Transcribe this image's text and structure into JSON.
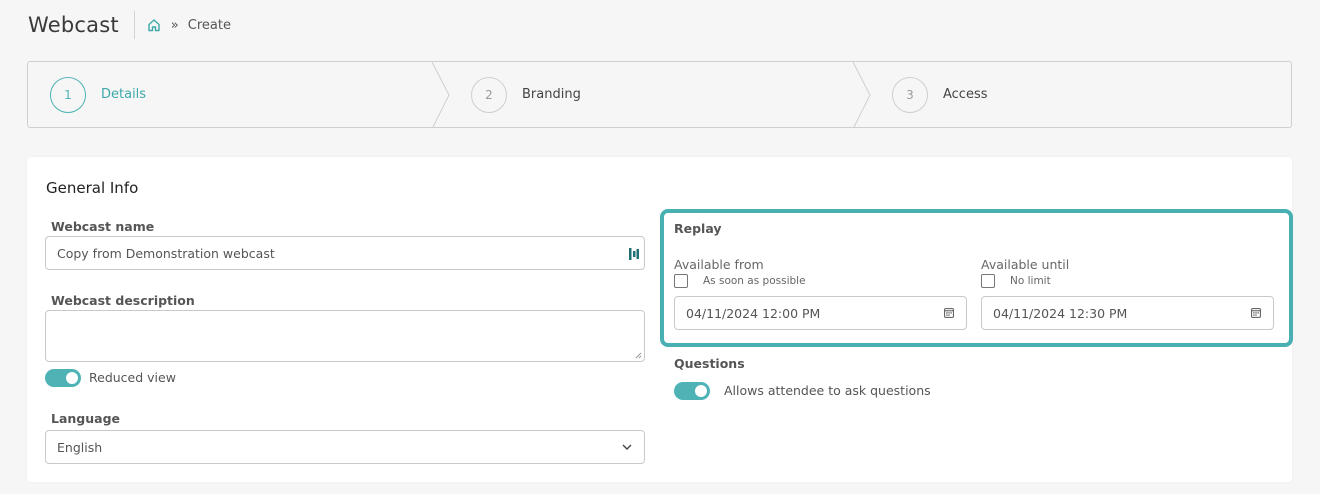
{
  "header": {
    "title": "Webcast",
    "breadcrumb_current": "Create",
    "separator": "»"
  },
  "stepper": {
    "steps": [
      {
        "number": "1",
        "label": "Details",
        "active": true
      },
      {
        "number": "2",
        "label": "Branding",
        "active": false
      },
      {
        "number": "3",
        "label": "Access",
        "active": false
      }
    ]
  },
  "general": {
    "section_title": "General Info",
    "name_label": "Webcast name",
    "name_value": "Copy from Demonstration webcast",
    "description_label": "Webcast description",
    "description_value": "",
    "reduced_view_label": "Reduced view",
    "language_label": "Language",
    "language_value": "English"
  },
  "replay": {
    "label": "Replay",
    "available_from_label": "Available from",
    "asap_label": "As soon as possible",
    "from_value": "04/11/2024 12:00  PM",
    "available_until_label": "Available until",
    "no_limit_label": "No limit",
    "until_value": "04/11/2024 12:30  PM"
  },
  "questions": {
    "label": "Questions",
    "toggle_label": "Allows attendee to ask questions"
  },
  "colors": {
    "accent": "#4fb3b5",
    "highlight_border": "#48b0b2"
  }
}
